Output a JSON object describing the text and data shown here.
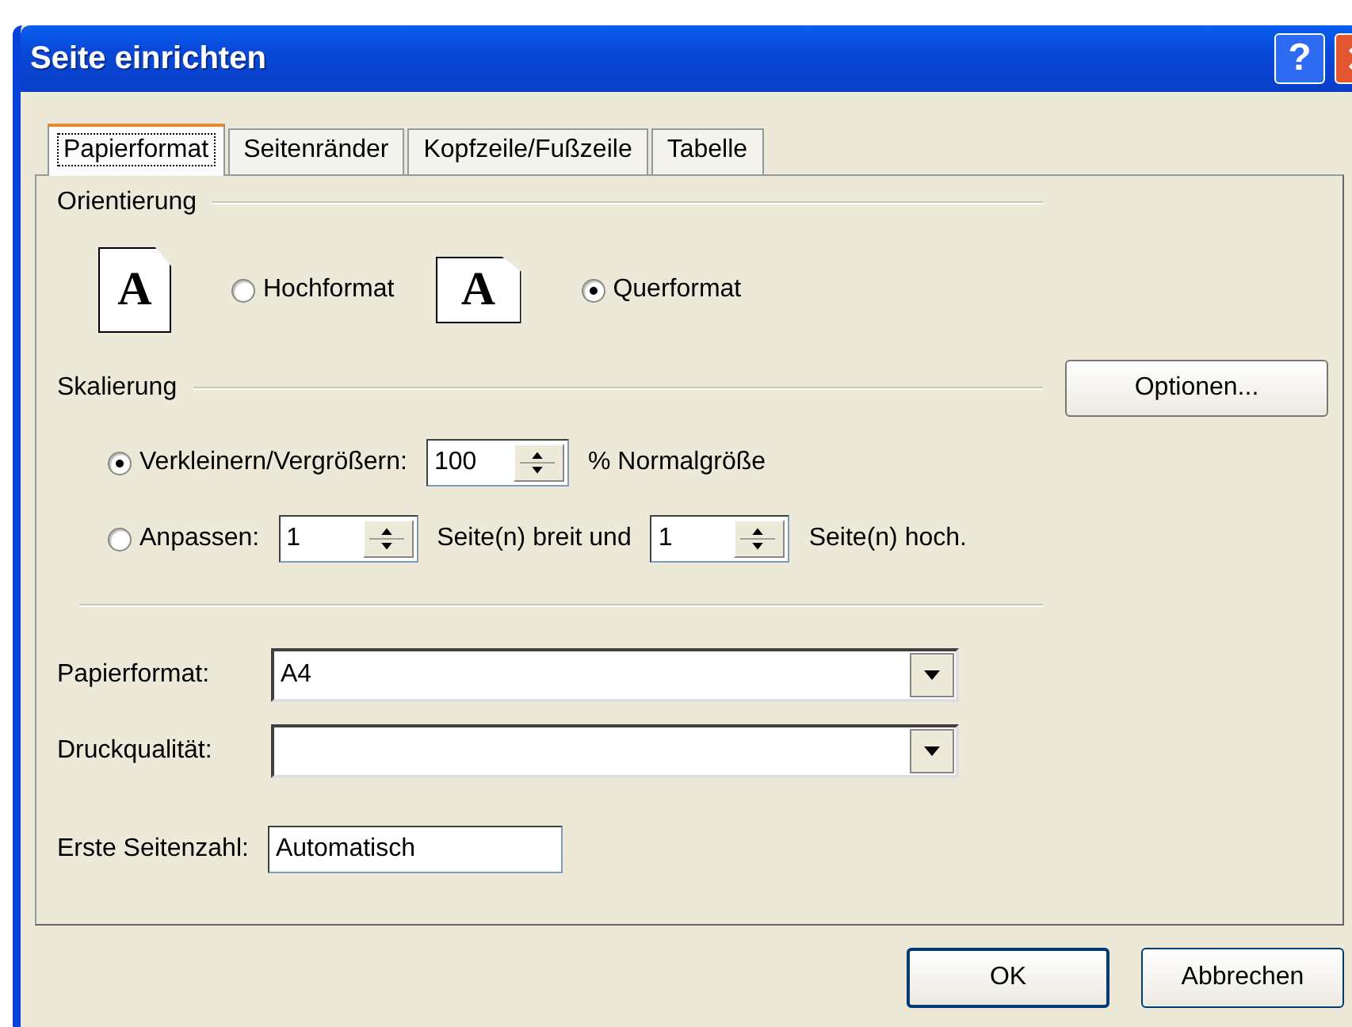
{
  "window": {
    "title": "Seite einrichten",
    "help_label": "?"
  },
  "tabs": [
    {
      "label": "Papierformat",
      "selected": true
    },
    {
      "label": "Seitenränder",
      "selected": false
    },
    {
      "label": "Kopfzeile/Fußzeile",
      "selected": false
    },
    {
      "label": "Tabelle",
      "selected": false
    }
  ],
  "orientation": {
    "label": "Orientierung",
    "options": [
      {
        "label": "Hochformat",
        "glyph": "A",
        "kind": "portrait",
        "selected": false
      },
      {
        "label": "Querformat",
        "glyph": "A",
        "kind": "landscape",
        "selected": true
      }
    ]
  },
  "scaling": {
    "label": "Skalierung",
    "options_button": "Optionen...",
    "rows": [
      {
        "label": "Verkleinern/Vergrößern:",
        "selected": true,
        "fields": [
          {
            "value": "100",
            "suffix": "% Normalgröße"
          }
        ]
      },
      {
        "label": "Anpassen:",
        "selected": false,
        "fields": [
          {
            "value": "1",
            "suffix": "Seite(n) breit und"
          },
          {
            "value": "1",
            "suffix": "Seite(n) hoch."
          }
        ]
      }
    ]
  },
  "paper": [
    {
      "label": "Papierformat:",
      "value": "A4"
    },
    {
      "label": "Druckqualität:"
    }
  ],
  "first_page": {
    "label": "Erste Seitenzahl:",
    "value": "Automatisch"
  },
  "buttons": [
    "OK",
    "Abbrechen"
  ]
}
